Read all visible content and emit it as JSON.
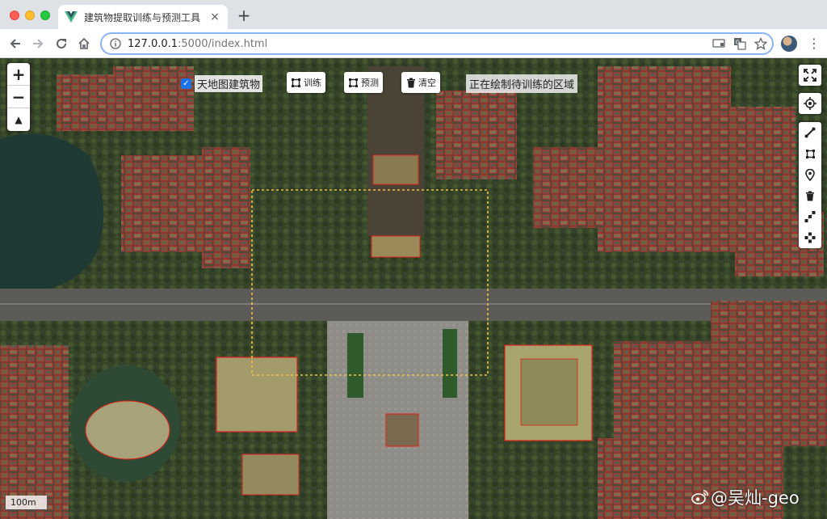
{
  "browser": {
    "tab_title": "建筑物提取训练与预测工具",
    "new_tab_label": "+",
    "close_label": "×",
    "url_host": "127.0.0.1",
    "url_path": ":5000/index.html",
    "menu_label": "⋮"
  },
  "map": {
    "zoom_in_label": "+",
    "zoom_out_label": "−",
    "compass_label": "▲",
    "layer_checkbox_checked": true,
    "layer_checkbox_mark": "✓",
    "layer_label": "天地图建筑物",
    "toolbar": {
      "train_label": "训练",
      "predict_label": "预测",
      "clear_label": "清空"
    },
    "status_message": "正在绘制待训练的区域",
    "scale_label": "100m",
    "right_tools": [
      "fullscreen-icon",
      "locate-icon",
      "draw-line-icon",
      "draw-rectangle-icon",
      "marker-icon",
      "delete-icon",
      "edit-icon",
      "drag-icon"
    ],
    "selection_color": "#f5c242",
    "building_outline_color": "#e0221a"
  },
  "watermark": {
    "text": "@吴灿-geo"
  }
}
